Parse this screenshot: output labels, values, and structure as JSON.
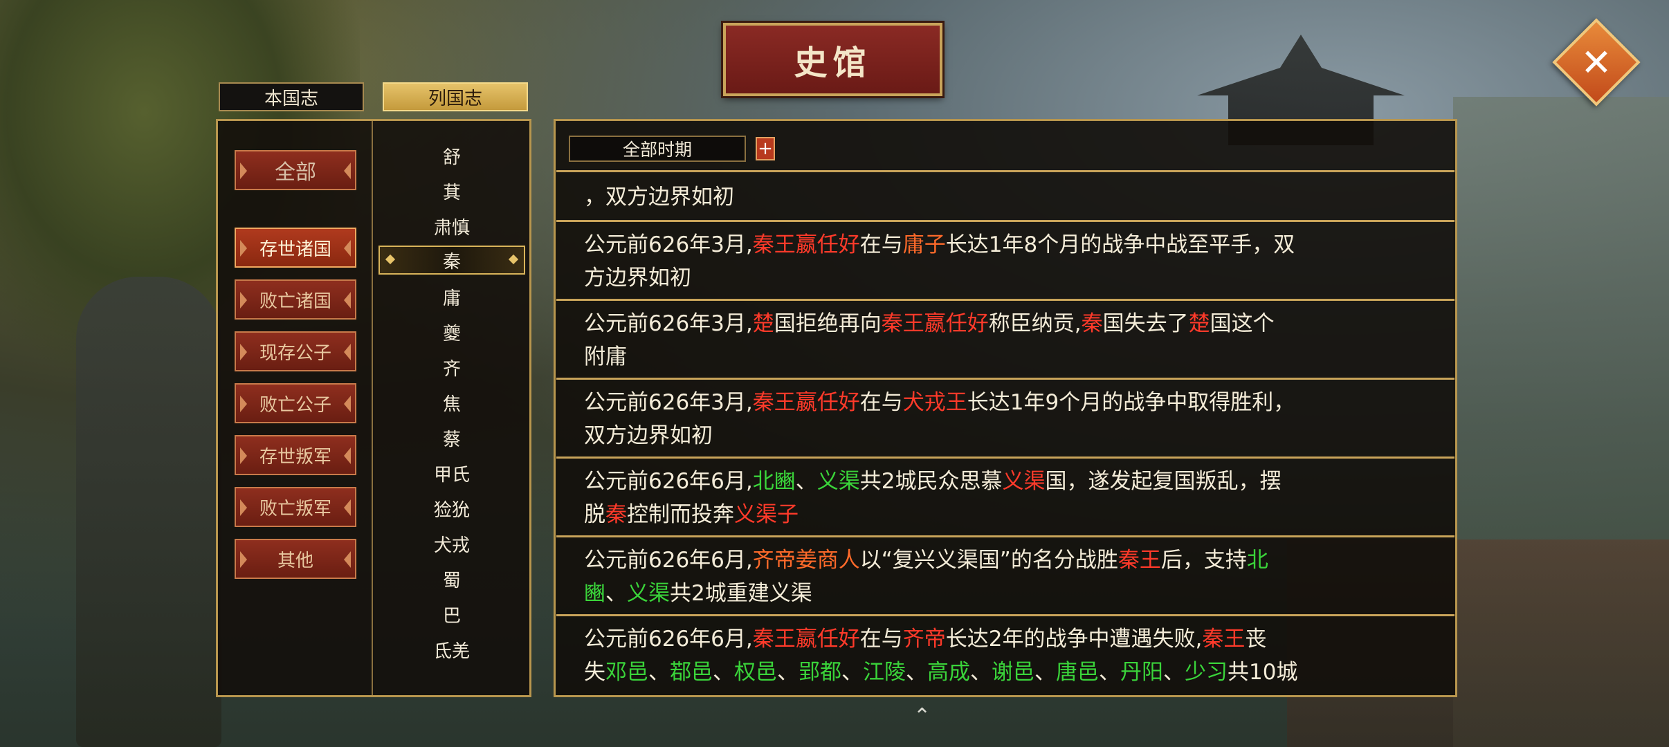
{
  "title": "史馆",
  "tabs": {
    "home": "本国志",
    "all": "列国志"
  },
  "categories": {
    "all": "全部",
    "items": [
      "存世诸国",
      "败亡诸国",
      "现存公子",
      "败亡公子",
      "存世叛军",
      "败亡叛军",
      "其他"
    ]
  },
  "nations": [
    "舒",
    "萁",
    "肃慎",
    "秦",
    "庸",
    "夔",
    "齐",
    "焦",
    "蔡",
    "甲氏",
    "猃狁",
    "犬戎",
    "蜀",
    "巴",
    "氐羌"
  ],
  "selected_nation": "秦",
  "period": {
    "label": "全部时期",
    "plus": "+"
  },
  "close_icon": "✕",
  "colors": {
    "red": "#ff3a2a",
    "orange": "#ff6a2a",
    "green": "#3ad43a",
    "gold": "#c9a45a"
  },
  "entries": [
    {
      "lines": [
        [
          [
            "，双方边界如初",
            ""
          ]
        ]
      ]
    },
    {
      "lines": [
        [
          [
            "公元前626年3月,",
            ""
          ],
          [
            "秦王嬴任好",
            "r"
          ],
          [
            "在与",
            ""
          ],
          [
            "庸子",
            "o"
          ],
          [
            "长达1年8个月的战争中战至平手，双",
            ""
          ]
        ],
        [
          [
            "方边界如初",
            ""
          ]
        ]
      ]
    },
    {
      "lines": [
        [
          [
            "公元前626年3月,",
            ""
          ],
          [
            "楚",
            "r"
          ],
          [
            "国拒绝再向",
            ""
          ],
          [
            "秦王嬴任好",
            "r"
          ],
          [
            "称臣纳贡,",
            ""
          ],
          [
            "秦",
            "r"
          ],
          [
            "国失去了",
            ""
          ],
          [
            "楚",
            "r"
          ],
          [
            "国这个",
            ""
          ]
        ],
        [
          [
            "附庸",
            ""
          ]
        ]
      ]
    },
    {
      "lines": [
        [
          [
            "公元前626年3月,",
            ""
          ],
          [
            "秦王嬴任好",
            "r"
          ],
          [
            "在与",
            ""
          ],
          [
            "犬戎王",
            "r"
          ],
          [
            "长达1年9个月的战争中取得胜利，",
            ""
          ]
        ],
        [
          [
            "双方边界如初",
            ""
          ]
        ]
      ]
    },
    {
      "lines": [
        [
          [
            "公元前626年6月,",
            ""
          ],
          [
            "北豳",
            "g"
          ],
          [
            "、",
            ""
          ],
          [
            "义渠",
            "g"
          ],
          [
            "共2城民众思慕",
            ""
          ],
          [
            "义渠",
            "r"
          ],
          [
            "国，遂发起复国叛乱，摆",
            ""
          ]
        ],
        [
          [
            "脱",
            ""
          ],
          [
            "秦",
            "r"
          ],
          [
            "控制而投奔",
            ""
          ],
          [
            "义渠子",
            "r"
          ]
        ]
      ]
    },
    {
      "lines": [
        [
          [
            "公元前626年6月,",
            ""
          ],
          [
            "齐帝姜商人",
            "o"
          ],
          [
            "以“复兴义渠国”的名分战胜",
            ""
          ],
          [
            "秦王",
            "r"
          ],
          [
            "后，支持",
            ""
          ],
          [
            "北",
            "g"
          ]
        ],
        [
          [
            "豳",
            "g"
          ],
          [
            "、",
            ""
          ],
          [
            "义渠",
            "g"
          ],
          [
            "共2城重建义渠",
            ""
          ]
        ]
      ]
    },
    {
      "lines": [
        [
          [
            "公元前626年6月,",
            ""
          ],
          [
            "秦王嬴任好",
            "r"
          ],
          [
            "在与",
            ""
          ],
          [
            "齐帝",
            "r"
          ],
          [
            "长达2年的战争中遭遇失败,",
            ""
          ],
          [
            "秦王",
            "r"
          ],
          [
            "丧",
            ""
          ]
        ],
        [
          [
            "失",
            ""
          ],
          [
            "邓邑",
            "g"
          ],
          [
            "、",
            ""
          ],
          [
            "鄀邑",
            "g"
          ],
          [
            "、",
            ""
          ],
          [
            "权邑",
            "g"
          ],
          [
            "、",
            ""
          ],
          [
            "郢都",
            "g"
          ],
          [
            "、",
            ""
          ],
          [
            "江陵",
            "g"
          ],
          [
            "、",
            ""
          ],
          [
            "高成",
            "g"
          ],
          [
            "、",
            ""
          ],
          [
            "谢邑",
            "g"
          ],
          [
            "、",
            ""
          ],
          [
            "唐邑",
            "g"
          ],
          [
            "、",
            ""
          ],
          [
            "丹阳",
            "g"
          ],
          [
            "、",
            ""
          ],
          [
            "少习",
            "g"
          ],
          [
            "共10城",
            ""
          ]
        ]
      ]
    }
  ]
}
